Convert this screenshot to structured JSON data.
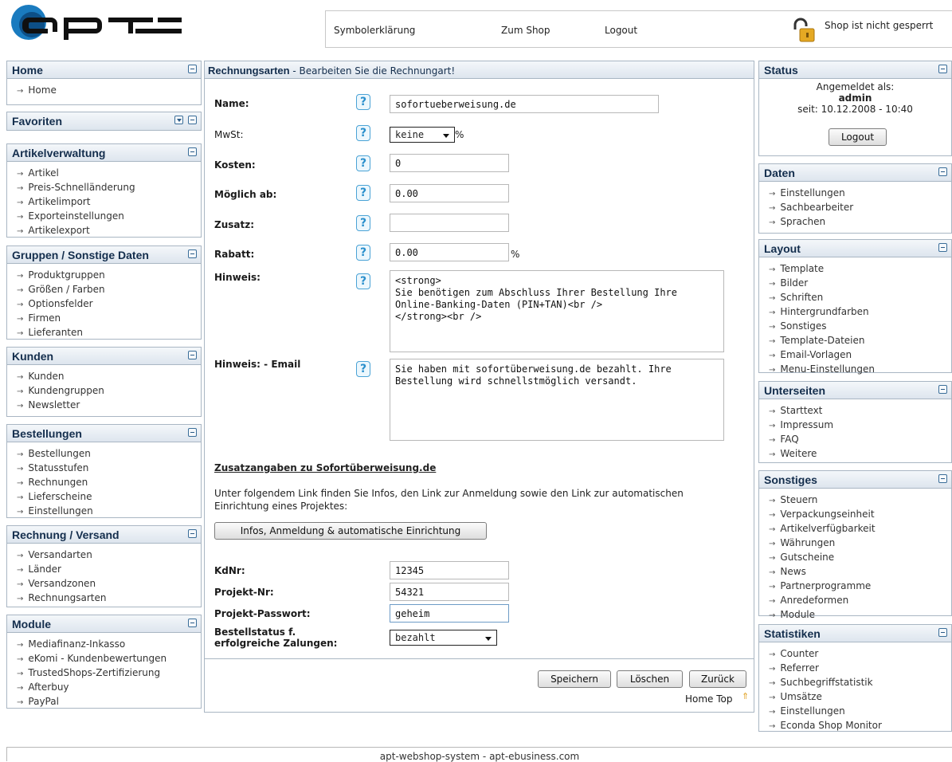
{
  "header": {
    "links": [
      "Symbolerklärung",
      "Zum Shop",
      "Logout"
    ],
    "lock_text": "Shop ist nicht gesperrt"
  },
  "left_panels": [
    {
      "title": "Home",
      "items": [
        "Home"
      ]
    },
    {
      "title": "Favoriten",
      "items": []
    },
    {
      "title": "Artikelverwaltung",
      "items": [
        "Artikel",
        "Preis-Schnelländerung",
        "Artikelimport",
        "Exporteinstellungen",
        "Artikelexport"
      ]
    },
    {
      "title": "Gruppen / Sonstige Daten",
      "items": [
        "Produktgruppen",
        "Größen / Farben",
        "Optionsfelder",
        "Firmen",
        "Lieferanten"
      ]
    },
    {
      "title": "Kunden",
      "items": [
        "Kunden",
        "Kundengruppen",
        "Newsletter"
      ]
    },
    {
      "title": "Bestellungen",
      "items": [
        "Bestellungen",
        "Statusstufen",
        "Rechnungen",
        "Lieferscheine",
        "Einstellungen"
      ]
    },
    {
      "title": "Rechnung / Versand",
      "items": [
        "Versandarten",
        "Länder",
        "Versandzonen",
        "Rechnungsarten"
      ]
    },
    {
      "title": "Module",
      "items": [
        "Mediafinanz-Inkasso",
        "eKomi - Kundenbewertungen",
        "TrustedShops-Zertifizierung",
        "Afterbuy",
        "PayPal"
      ]
    }
  ],
  "right_panels": [
    {
      "title": "Daten",
      "items": [
        "Einstellungen",
        "Sachbearbeiter",
        "Sprachen"
      ]
    },
    {
      "title": "Layout",
      "items": [
        "Template",
        "Bilder",
        "Schriften",
        "Hintergrundfarben",
        "Sonstiges",
        "Template-Dateien",
        "Email-Vorlagen",
        "Menu-Einstellungen"
      ]
    },
    {
      "title": "Unterseiten",
      "items": [
        "Starttext",
        "Impressum",
        "FAQ",
        "Weitere"
      ]
    },
    {
      "title": "Sonstiges",
      "items": [
        "Steuern",
        "Verpackungseinheit",
        "Artikelverfügbarkeit",
        "Währungen",
        "Gutscheine",
        "News",
        "Partnerprogramme",
        "Anredeformen",
        "Module"
      ]
    },
    {
      "title": "Statistiken",
      "items": [
        "Counter",
        "Referrer",
        "Suchbegriffstatistik",
        "Umsätze",
        "Einstellungen",
        "Econda Shop Monitor"
      ]
    }
  ],
  "status": {
    "title": "Status",
    "logged_in_as": "Angemeldet als:",
    "user": "admin",
    "since": "seit: 10.12.2008 - 10:40",
    "logout": "Logout"
  },
  "main": {
    "title": "Rechnungsarten",
    "subtitle": " - Bearbeiten Sie die Rechnungart!",
    "labels": {
      "name": "Name:",
      "mwst": "MwSt:",
      "kosten": "Kosten:",
      "moeglich": "Möglich ab:",
      "zusatz": "Zusatz:",
      "rabatt": "Rabatt:",
      "hinweis": "Hinweis:",
      "hinweis_email": "Hinweis: - Email"
    },
    "help_glyph": "?",
    "values": {
      "name": "sofortueberweisung.de",
      "mwst": "keine",
      "mwst_unit": "%",
      "kosten": "0",
      "moeglich": "0.00",
      "zusatz": "",
      "rabatt": "0.00",
      "rabatt_unit": "%",
      "hinweis": "<strong>\nSie benötigen zum Abschluss Ihrer Bestellung Ihre Online-Banking-Daten (PIN+TAN)<br />\n</strong><br />",
      "hinweis_email": "Sie haben mit sofortüberweisung.de bezahlt. Ihre Bestellung wird schnellstmöglich versandt."
    },
    "extra_title": "Zusatzangaben zu Sofortüberweisung.de",
    "extra_text": "Unter folgendem Link finden Sie Infos, den Link zur Anmeldung sowie den Link zur automatischen Einrichtung eines Projektes:",
    "extra_button": "Infos, Anmeldung & automatische Einrichtung",
    "kdnr_label": "KdNr:",
    "kdnr": "12345",
    "projekt_label": "Projekt-Nr:",
    "projekt": "54321",
    "passwort_label": "Projekt-Passwort:",
    "passwort": "geheim",
    "bestell_label": "Bestellstatus f. erfolgreiche Zalungen:",
    "bestell": "bezahlt",
    "buttons": {
      "save": "Speichern",
      "delete": "Löschen",
      "back": "Zurück"
    },
    "home_top": "Home Top"
  },
  "footer": "apt-webshop-system - apt-ebusiness.com"
}
